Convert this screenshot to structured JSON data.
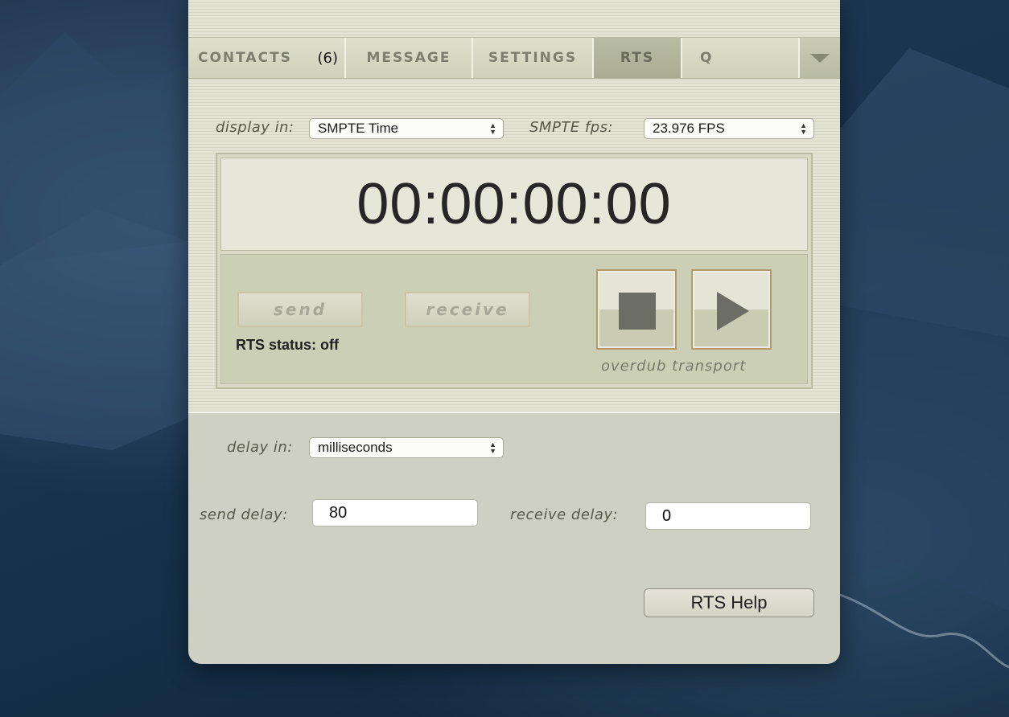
{
  "tabs": {
    "contacts_label": "CONTACTS",
    "contacts_count": "(6)",
    "message_label": "MESSAGE",
    "settings_label": "SETTINGS",
    "rts_label": "RTS",
    "search_text": "Q",
    "active_tab": "RTS"
  },
  "display": {
    "display_in_label": "display in:",
    "display_in_value": "SMPTE Time",
    "fps_label": "SMPTE fps:",
    "fps_value": "23.976 FPS"
  },
  "timecode": "00:00:00:00",
  "transport": {
    "send_label": "send",
    "receive_label": "receive",
    "rts_status": "RTS status: off",
    "overdub_label": "overdub transport",
    "stop_icon": "stop-icon",
    "play_icon": "play-icon"
  },
  "delay": {
    "delay_in_label": "delay in:",
    "delay_in_value": "milliseconds",
    "send_delay_label": "send delay:",
    "send_delay_value": "80",
    "receive_delay_label": "receive delay:",
    "receive_delay_value": "0"
  },
  "help_label": "RTS Help",
  "colors": {
    "panel_bg": "#e2e3d2",
    "lower_bg": "#cfd0c4",
    "tab_active": "#a9ac92",
    "transport_border": "#b29a6c",
    "desktop_bg": "#1b3550"
  }
}
